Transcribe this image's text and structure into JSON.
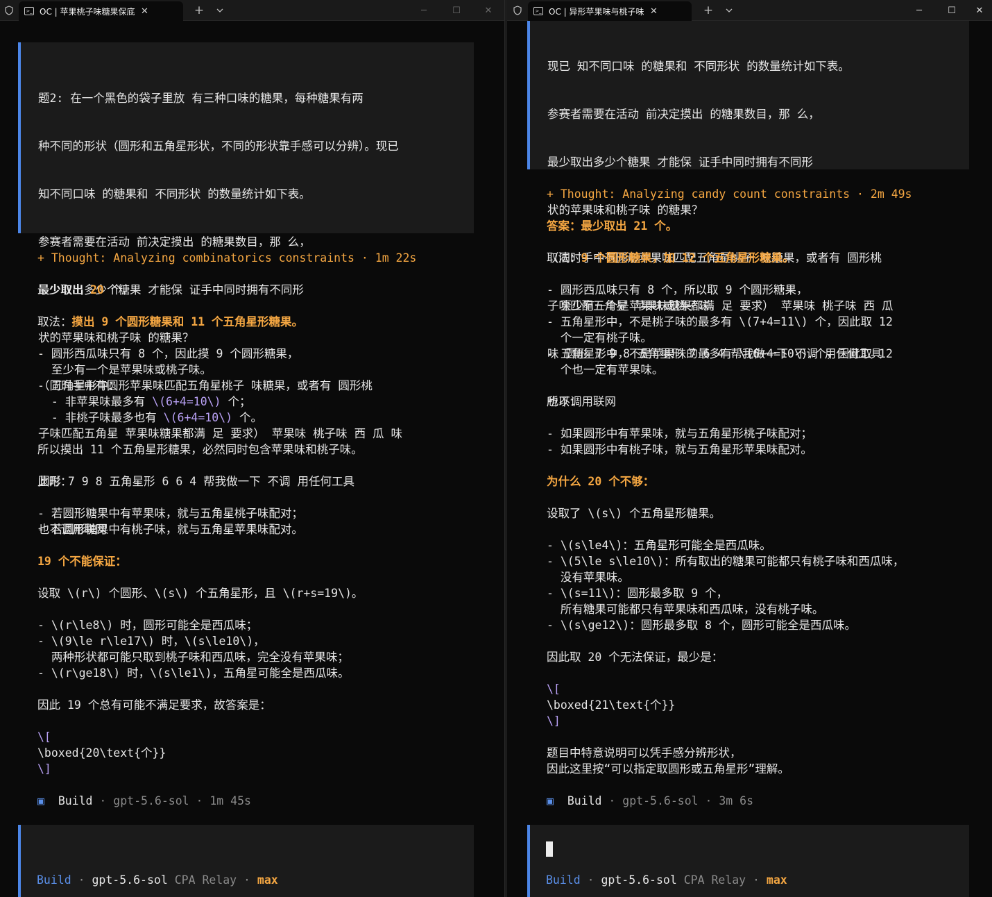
{
  "left": {
    "tab_title": "OC | 苹果桃子味糖果保底抽取",
    "question_lines": [
      "题2: 在一个黑色的袋子里放 有三种口味的糖果，每种糖果有两",
      "种不同的形状（圆形和五角星形状，不同的形状靠手感可以分辨）。现已",
      "知不同口味 的糖果和 不同形状 的数量统计如下表。",
      "参赛者需要在活动 前决定摸出 的糖果数目，那 么，",
      "最少取出多少个糖果 才能保 证手中同时拥有不同形",
      "状的苹果味和桃子味 的糖果？",
      "（同时手中有圆形苹果味匹配五角星桃子 味糖果，或者有 圆形桃",
      "子味匹配五角星 苹果味糖果都满 足 要求） 苹果味 桃子味 西 瓜 味",
      "圆形 7 9 8 五角星形 6 6 4 帮我做一下 不调 用任何工具",
      "也不调用联网"
    ],
    "thought": "+ Thought: Analyzing combinatorics constraints · 1m 22s",
    "answer_pre": "最少取出 ",
    "answer_num": "20",
    "answer_post": " 个。",
    "method_label": "取法：",
    "method_text": "摸出 9 个圆形糖果和 11 个五角星形糖果。",
    "b1a": "- 圆形西瓜味只有 8 个，因此摸 9 个圆形糖果，",
    "b1b": "  至少有一个是苹果味或桃子味。",
    "b2": "- 五角星形中：",
    "b2a_pre": "  - 非苹果味最多有 ",
    "b2a_tex": "\\(6+4=10\\)",
    "b2a_post": " 个；",
    "b2b_pre": "  - 非桃子味最多也有 ",
    "b2b_tex": "\\(6+4=10\\)",
    "b2b_post": " 个。",
    "so_line": "所以摸出 11 个五角星形糖果，必然同时包含苹果味和桃子味。",
    "now": "此时：",
    "now1": "- 若圆形糖果中有苹果味，就与五角星桃子味配对；",
    "now2": "- 若圆形糖果中有桃子味，就与五角星苹果味配对。",
    "why_heading": "19 个不能保证：",
    "set_line": "设取 \\(r\\) 个圆形、\\(s\\) 个五角星形，且 \\(r+s=19\\)。",
    "c1": "- \\(r\\le8\\) 时，圆形可能全是西瓜味；",
    "c2": "- \\(9\\le r\\le17\\) 时，\\(s\\le10\\)，",
    "c2b": "  两种形状都可能只取到桃子味和西瓜味，完全没有苹果味；",
    "c3": "- \\(r\\ge18\\) 时，\\(s\\le1\\)，五角星可能全是西瓜味。",
    "therefore": "因此 19 个总有可能不满足要求，故答案是：",
    "box1": "\\[",
    "box2": "\\boxed{20\\text{个}}",
    "box3": "\\]",
    "build_label": "Build",
    "build_model": " · gpt-5.6-sol · 1m 45s",
    "status_build": "Build",
    "status_model": "gpt-5.6-sol",
    "status_relay": "CPA Relay",
    "status_max": "max"
  },
  "right": {
    "tab_title": "OC | 异形苹果味与桃子味糖果",
    "question_lines": [
      "现已 知不同口味 的糖果和 不同形状 的数量统计如下表。",
      "参赛者需要在活动 前决定摸出 的糖果数目，那 么，",
      "最少取出多少个糖果 才能保 证手中同时拥有不同形",
      "状的苹果味和桃子味 的糖果？",
      "（同时手中有圆形苹果味匹配五角星桃子 味糖果，或者有 圆形桃",
      "子味匹配五角星 苹果味糖果都满 足 要求） 苹果味 桃子味 西 瓜",
      "味 圆形 7 9 8 五角星形 7 6 4 帮我做一下 不调 用任何工具",
      "也不调用联网"
    ],
    "thought": "+ Thought: Analyzing candy count constraints · 2m 49s",
    "answer": "答案：最少取出 21 个。",
    "method_label": "取法：",
    "method_text": "9 个圆形糖果，加 12 个五角星形糖果。",
    "b1a": "- 圆形西瓜味只有 8 个，所以取 9 个圆形糖果，",
    "b1b": "  至少有一个是苹果味或桃子味。",
    "b2a": "- 五角星形中，不是桃子味的最多有 \\(7+4=11\\) 个，因此取 12",
    "b2b": "  个一定有桃子味。",
    "b3a": "- 五角星形中，不是苹果味的最多有 \\(6+4=10\\) 个，因此取 12",
    "b3b": "  个也一定有苹果味。",
    "so": "所以：",
    "so1": "- 如果圆形中有苹果味，就与五角星形桃子味配对；",
    "so2": "- 如果圆形中有桃子味，就与五角星形苹果味配对。",
    "why_heading": "为什么 20 个不够：",
    "set_line": "设取了 \\(s\\) 个五角星形糖果。",
    "c1": "- \\(s\\le4\\)：五角星形可能全是西瓜味。",
    "c2": "- \\(5\\le s\\le10\\)：所有取出的糖果可能都只有桃子味和西瓜味，",
    "c2b": "  没有苹果味。",
    "c3": "- \\(s=11\\)：圆形最多取 9 个，",
    "c3b": "  所有糖果可能都只有苹果味和西瓜味，没有桃子味。",
    "c4": "- \\(s\\ge12\\)：圆形最多取 8 个，圆形可能全是西瓜味。",
    "therefore": "因此取 20 个无法保证，最少是：",
    "box1": "\\[",
    "box2": "\\boxed{21\\text{个}}",
    "box3": "\\]",
    "note1": "题目中特意说明可以凭手感分辨形状，",
    "note2": "因此这里按“可以指定取圆形或五角星形”理解。",
    "build_label": "Build",
    "build_model": " · gpt-5.6-sol · 3m 6s",
    "status_build": "Build",
    "status_model": "gpt-5.6-sol",
    "status_relay": "CPA Relay",
    "status_max": "max"
  },
  "tabbar": {
    "new_tab": "+",
    "dropdown": "⌄",
    "minimize": "─",
    "maximize": "☐",
    "close": "✕"
  }
}
